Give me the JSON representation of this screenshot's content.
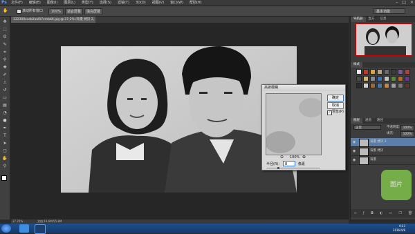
{
  "app": {
    "logo": "Ps",
    "menu": [
      "文件(F)",
      "编辑(E)",
      "图像(I)",
      "图层(L)",
      "类型(Y)",
      "选择(S)",
      "滤镜(T)",
      "3D(D)",
      "视图(V)",
      "窗口(W)",
      "帮助(H)"
    ],
    "window_controls": [
      "–",
      "□",
      "×"
    ]
  },
  "options_bar": {
    "scroll_all_label": "滚动所有窗口",
    "zoom_100": "100%",
    "fit_screen": "适合屏幕",
    "fill_screen": "填充屏幕",
    "workspace": "基本功能"
  },
  "document": {
    "tab_title": "122300xxsb2aol07vmbb6.jpg @ 27.2% (背景 拷贝 2, RGB/8#) *",
    "zoom": "27.25%",
    "doc_size": "文档:19.6M/55.8M"
  },
  "dialog": {
    "title": "高斯模糊",
    "ok": "确定",
    "cancel": "取消",
    "preview_label": "预览(P)",
    "preview_checked": true,
    "zoom": "100%",
    "radius_label": "半径(R):",
    "radius_value": "8",
    "radius_unit": "像素",
    "radius_fraction": 0.22
  },
  "panels": {
    "navigator_tabs": [
      "导航器",
      "直方",
      "信息"
    ],
    "styles_tabs": [
      "样式"
    ],
    "layers_tabs": [
      "图层",
      "通道",
      "路径"
    ],
    "blend_mode": "正常",
    "opacity_label": "不透明度:",
    "opacity": "100%",
    "fill_label": "填充:",
    "fill": "100%",
    "layers": [
      {
        "name": "背景 拷贝 2",
        "selected": true
      },
      {
        "name": "背景 拷贝",
        "selected": false
      },
      {
        "name": "背景",
        "selected": false
      }
    ],
    "layer_bottom_icons": [
      "link-icon",
      "fx-icon",
      "mask-icon",
      "adjustment-icon",
      "folder-icon",
      "new-layer-icon",
      "trash-icon"
    ]
  },
  "watermark": "图片",
  "taskbar": {
    "time": "9:23",
    "date": "2016/4/8"
  }
}
